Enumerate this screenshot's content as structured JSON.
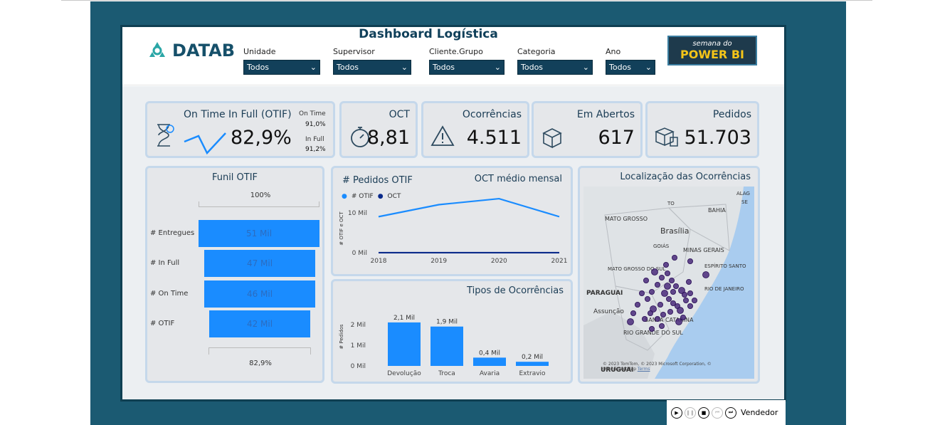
{
  "header": {
    "title": "Dashboard Logística",
    "logo_text": "DATAB",
    "brand_line1": "semana do",
    "brand_line2": "POWER BI"
  },
  "slicers": [
    {
      "label": "Unidade",
      "value": "Todos"
    },
    {
      "label": "Supervisor",
      "value": "Todos"
    },
    {
      "label": "Cliente.Grupo",
      "value": "Todos"
    },
    {
      "label": "Categoria",
      "value": "Todos"
    },
    {
      "label": "Ano",
      "value": "Todos"
    }
  ],
  "kpis": {
    "otif": {
      "title": "On Time In Full (OTIF)",
      "value": "82,9%",
      "on_time_label": "On Time",
      "on_time_value": "91,0%",
      "in_full_label": "In Full",
      "in_full_value": "91,2%"
    },
    "oct": {
      "title": "OCT",
      "value": "8,81"
    },
    "ocorrencias": {
      "title": "Ocorrências",
      "value": "4.511"
    },
    "em_abertos": {
      "title": "Em Abertos",
      "value": "617"
    },
    "pedidos": {
      "title": "Pedidos",
      "value": "51.703"
    }
  },
  "funnel": {
    "title": "Funil OTIF",
    "top_pct": "100%",
    "bottom_pct": "82,9%",
    "stages": [
      {
        "label": "# Entregues",
        "value_text": "51 Mil",
        "value": 51
      },
      {
        "label": "# In Full",
        "value_text": "47 Mil",
        "value": 47
      },
      {
        "label": "# On Time",
        "value_text": "46 Mil",
        "value": 46
      },
      {
        "label": "# OTIF",
        "value_text": "42 Mil",
        "value": 42
      }
    ]
  },
  "chart_data": [
    {
      "type": "line",
      "title": "# Pedidos OTIF",
      "subtitle": "OCT médio mensal",
      "ylabel": "# OTIF e OCT",
      "x": [
        "2018",
        "2019",
        "2020",
        "2021"
      ],
      "series": [
        {
          "name": "# OTIF",
          "values": [
            9,
            12,
            13.5,
            9
          ]
        },
        {
          "name": "OCT",
          "values": [
            0.01,
            0.01,
            0.01,
            0.01
          ]
        }
      ],
      "yticks": [
        "0 Mil",
        "10 Mil"
      ],
      "ylim": [
        0,
        16
      ],
      "legend": "top-left"
    },
    {
      "type": "bar",
      "title": "Tipos de Ocorrências",
      "ylabel": "# Pedidos",
      "categories": [
        "Devolução",
        "Troca",
        "Avaria",
        "Extravio"
      ],
      "values": [
        2.1,
        1.9,
        0.4,
        0.2
      ],
      "data_labels": [
        "2,1 Mil",
        "1,9 Mil",
        "0,4 Mil",
        "0,2 Mil"
      ],
      "yticks": [
        "0 Mil",
        "1 Mil",
        "2 Mil"
      ],
      "ylim": [
        0,
        2.2
      ]
    }
  ],
  "map": {
    "title": "Localização das Ocorrências",
    "labels": [
      "MATO GROSSO",
      "TO",
      "BAHIA",
      "Brasília",
      "GOIÁS",
      "MINAS GERAIS",
      "MATO GROSSO DO SUL",
      "ESPÍRITO SANTO",
      "PARAGUAI",
      "RIO DE JANEIRO",
      "Assunção",
      "SANTA CATARINA",
      "RIO GRANDE DO SUL",
      "URUGUAI",
      "ALAG",
      "SE"
    ],
    "attribution": "© 2023 TomTom, © 2023 Microsoft Corporation, © OpenStreetMap",
    "terms": "Terms"
  },
  "player": {
    "label": "Vendedor"
  },
  "colors": {
    "accent": "#1a8cff",
    "frame": "#1b5a72",
    "dark": "#12405a"
  }
}
